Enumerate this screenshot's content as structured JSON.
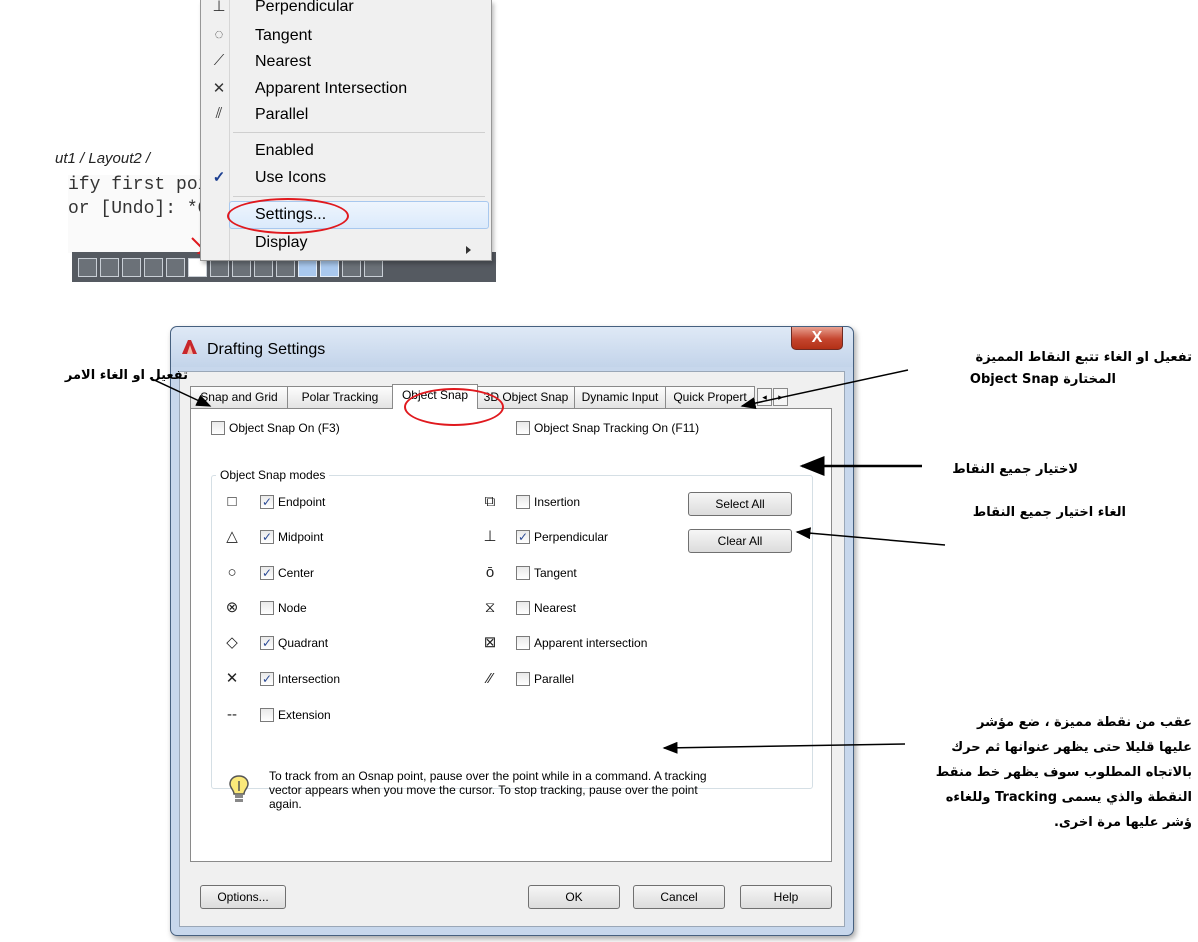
{
  "menu": {
    "items": [
      {
        "label": "Perpendicular",
        "icon": "perpendicular-icon"
      },
      {
        "label": "Tangent",
        "icon": "tangent-icon"
      },
      {
        "label": "Nearest",
        "icon": "nearest-icon"
      },
      {
        "label": "Apparent Intersection",
        "icon": "apparent-intersection-icon"
      },
      {
        "label": "Parallel",
        "icon": "parallel-icon"
      }
    ],
    "enabled": "Enabled",
    "use_icons": "Use Icons",
    "settings": "Settings...",
    "display": "Display"
  },
  "cad": {
    "layout_tabs": "ut1 / Layout2 /",
    "command_lines": [
      "ify first poi",
      "or [Undo]: *C"
    ]
  },
  "dialog": {
    "title": "Drafting Settings",
    "close": "X",
    "tabs": [
      "Snap and Grid",
      "Polar Tracking",
      "Object Snap",
      "3D Object Snap",
      "Dynamic Input",
      "Quick Propert"
    ],
    "active_tab": "Object Snap",
    "osnap_on": {
      "label": "Object Snap On (F3)",
      "checked": false
    },
    "tracking_on": {
      "label": "Object Snap Tracking On (F11)",
      "checked": false
    },
    "modes_title": "Object Snap modes",
    "modes_left": [
      {
        "label": "Endpoint",
        "checked": true,
        "symbol": "□"
      },
      {
        "label": "Midpoint",
        "checked": true,
        "symbol": "△"
      },
      {
        "label": "Center",
        "checked": true,
        "symbol": "○"
      },
      {
        "label": "Node",
        "checked": false,
        "symbol": "⊗"
      },
      {
        "label": "Quadrant",
        "checked": true,
        "symbol": "◇"
      },
      {
        "label": "Intersection",
        "checked": true,
        "symbol": "✕"
      },
      {
        "label": "Extension",
        "checked": false,
        "symbol": "--"
      }
    ],
    "modes_right": [
      {
        "label": "Insertion",
        "checked": false,
        "symbol": "⧉"
      },
      {
        "label": "Perpendicular",
        "checked": true,
        "symbol": "⊥"
      },
      {
        "label": "Tangent",
        "checked": false,
        "symbol": "ō"
      },
      {
        "label": "Nearest",
        "checked": false,
        "symbol": "⧖"
      },
      {
        "label": "Apparent intersection",
        "checked": false,
        "symbol": "⊠"
      },
      {
        "label": "Parallel",
        "checked": false,
        "symbol": "⁄⁄"
      }
    ],
    "select_all": "Select All",
    "clear_all": "Clear All",
    "tip": "To track from an Osnap point, pause over the point while in a command.  A tracking vector appears when you move the cursor.  To stop tracking, pause over the point again.",
    "options": "Options...",
    "ok": "OK",
    "cancel": "Cancel",
    "help": "Help"
  },
  "annotations": {
    "toggle_command": "تفعيل او الغاء الامر",
    "tracking_line1": "تفعيل او الغاء تتبع النقاط المميزة",
    "tracking_line2": "المختارة Object Snap",
    "select_all_note": "لاختيار جميع النقاط",
    "clear_all_note": "الغاء اختيار جميع النقاط",
    "tracking_note": [
      "عقب من نقطة مميزة ، ضع مؤشر",
      "عليها قليلا حتى يظهر عنوانها ثم حرك",
      "بالاتجاه المطلوب سوف يظهر خط منقط",
      "النقطة والذي يسمى  Tracking وللغاءه",
      "ؤشر عليها مرة اخرى."
    ]
  },
  "colors": {
    "highlight_ring": "#e0191e",
    "checkmark": "#2b4a95"
  }
}
